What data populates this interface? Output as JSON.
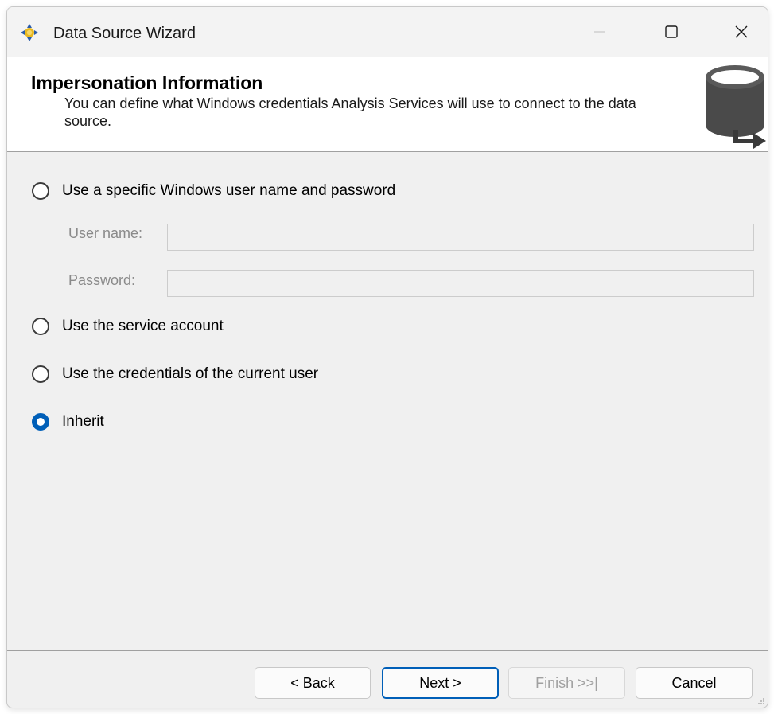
{
  "window": {
    "title": "Data Source Wizard",
    "icons": [
      "app-icon",
      "minimize-icon",
      "maximize-icon",
      "close-icon"
    ]
  },
  "header": {
    "title": "Impersonation Information",
    "description": "You can define what Windows credentials Analysis Services will use to connect to the data source.",
    "icon": "database-arrow-icon"
  },
  "options": {
    "specific_user": {
      "label": "Use a specific Windows user name and password",
      "checked": false
    },
    "service_account": {
      "label": "Use the service account",
      "checked": false
    },
    "current_user": {
      "label": "Use the credentials of the current user",
      "checked": false
    },
    "inherit": {
      "label": "Inherit",
      "checked": true
    }
  },
  "fields": {
    "username_label": "User name:",
    "username_value": "",
    "password_label": "Password:",
    "password_value": ""
  },
  "buttons": {
    "back": "< Back",
    "next": "Next >",
    "finish": "Finish >>|",
    "cancel": "Cancel"
  },
  "colors": {
    "accent": "#005fb8",
    "window_bg": "#f0f0f0",
    "disabled_text": "#a0a0a0"
  }
}
